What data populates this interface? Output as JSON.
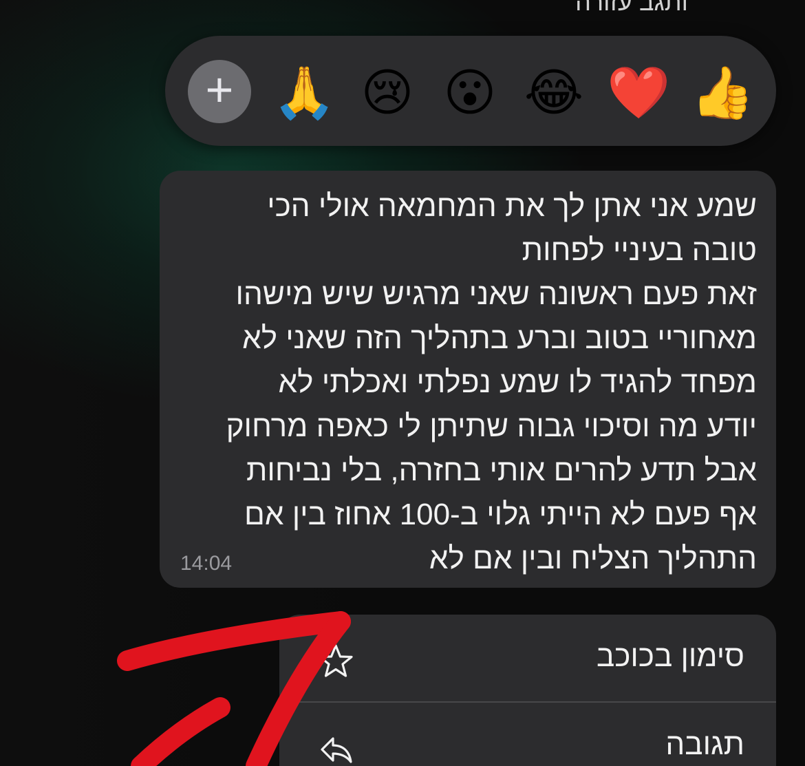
{
  "top_cut_text": "ותגב עזורה",
  "reactions": {
    "add_label": "+",
    "emojis": [
      "🙏",
      "😢",
      "😮",
      "😂",
      "❤️",
      "👍"
    ]
  },
  "message": {
    "lines": [
      "שמע אני אתן לך את המחמאה אולי הכי",
      "טובה בעיניי לפחות",
      "זאת פעם ראשונה שאני מרגיש שיש מישהו",
      "מאחוריי בטוב וברע בתהליך הזה שאני לא",
      "מפחד להגיד לו שמע נפלתי ואכלתי לא",
      "יודע מה וסיכוי גבוה שתיתן לי כאפה מרחוק",
      "אבל תדע להרים אותי בחזרה, בלי נביחות",
      "אף פעם לא הייתי גלוי ב-100 אחוז בין אם",
      "התהליך הצליח ובין אם לא"
    ],
    "time": "14:04"
  },
  "menu": {
    "star_label": "סימון בכוכב",
    "reply_label": "תגובה"
  },
  "colors": {
    "annotation": "#e0141e",
    "bubble": "#2c2c2e"
  }
}
